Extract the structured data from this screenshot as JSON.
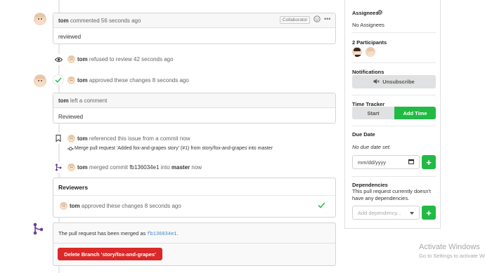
{
  "comment1": {
    "author": "tom",
    "action": "commented 56 seconds ago",
    "badge": "Collaborator",
    "body": "reviewed"
  },
  "event_refuse": {
    "author": "tom",
    "text": "refused to review 42 seconds ago"
  },
  "event_approve": {
    "author": "tom",
    "text": "approved these changes 8 seconds ago"
  },
  "review_comment": {
    "author": "tom",
    "action": "left a comment",
    "body": "Reviewed"
  },
  "event_ref": {
    "author": "tom",
    "text": "referenced this issue from a commit now",
    "commit_msg": "Merge pull request 'Added fox-and-grapes story' (#1) from story/fox-and-grapes into master"
  },
  "event_merge": {
    "author": "tom",
    "text_a": "merged commit",
    "commit": "fb136034e1",
    "text_b": "into",
    "branch": "master",
    "text_c": "now"
  },
  "reviewers": {
    "title": "Reviewers",
    "row_author": "tom",
    "row_text": "approved these changes 8 seconds ago"
  },
  "merge_box": {
    "text": "The pull request has been merged as",
    "commit": "fb136034e1",
    "period": ".",
    "delete_label": "Delete Branch 'story/fox-and-grapes'"
  },
  "sidebar": {
    "assignees_title": "Assignees",
    "assignees_value": "No Assignees",
    "participants_title": "2 Participants",
    "notifications_title": "Notifications",
    "unsubscribe_label": "Unsubscribe",
    "time_tracker_title": "Time Tracker",
    "start_label": "Start",
    "add_time_label": "Add Time",
    "due_date_title": "Due Date",
    "due_date_value": "No due date set.",
    "date_placeholder": "mm/dd/yyyy",
    "dependencies_title": "Dependencies",
    "dependencies_value": "This pull request currently doesn't have any dependencies.",
    "add_dependency_placeholder": "Add dependency..."
  },
  "watermark": {
    "title": "Activate Windows",
    "subtitle": "Go to Settings to activate Windows."
  },
  "colors": {
    "green": "#21ba45",
    "red": "#db2828",
    "grey_button": "#e0e1e2",
    "purple_icon": "#6c3f95"
  },
  "icons": [
    "eye-icon",
    "check-icon",
    "bookmark-icon",
    "commit-icon",
    "merge-icon",
    "gear-icon",
    "smiley-icon",
    "more-icon",
    "bell-mute-icon",
    "calendar-icon",
    "plus-icon",
    "chevron-down-icon"
  ]
}
